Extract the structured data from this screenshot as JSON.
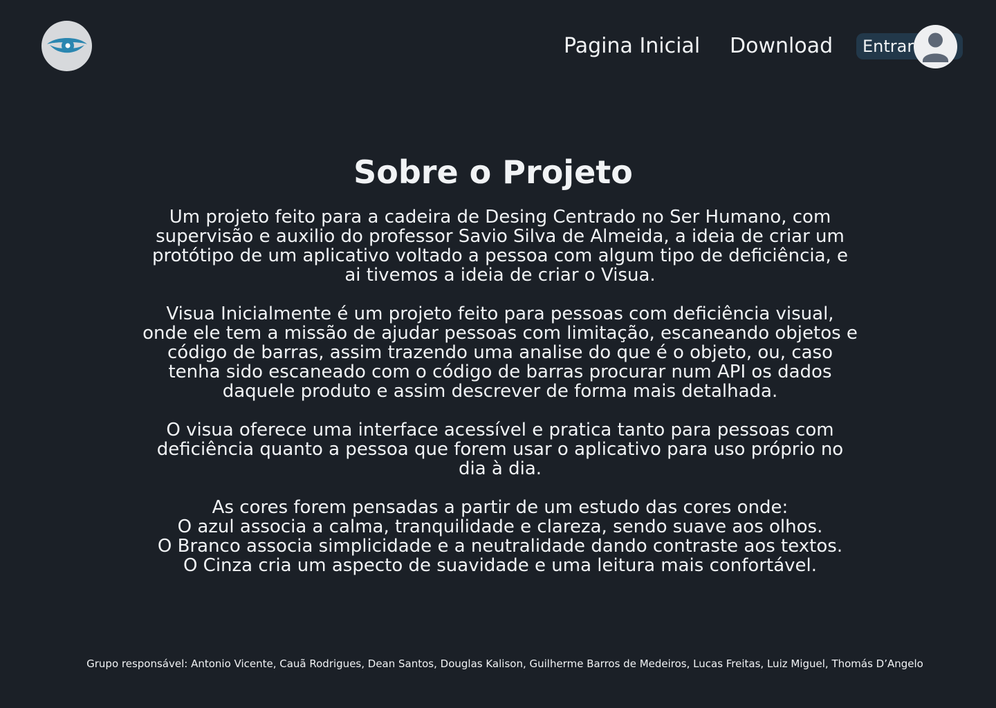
{
  "header": {
    "logo_icon": "eye-icon",
    "nav": [
      {
        "label": "Pagina Inicial"
      },
      {
        "label": "Download"
      }
    ],
    "login_label": "Entrar",
    "avatar_icon": "user-avatar-icon"
  },
  "main": {
    "title": "Sobre o Projeto",
    "paragraphs": [
      "Um projeto feito para a cadeira de Desing Centrado no Ser Humano, com supervisão e auxilio do professor Savio Silva de Almeida, a ideia de criar um protótipo de um aplicativo voltado a pessoa com algum tipo de deficiência, e ai tivemos a ideia de criar o Visua.",
      "Visua Inicialmente é um projeto feito para pessoas com deficiência visual, onde ele tem a missão de ajudar pessoas com limitação, escaneando objetos e código de barras, assim trazendo uma analise do que é o objeto, ou, caso tenha sido escaneado com o código de barras procurar num API os dados daquele produto e assim descrever de forma mais detalhada.",
      "O visua oferece uma interface acessível e pratica tanto para pessoas com deficiência quanto a pessoa que forem usar o aplicativo para uso próprio no dia à dia."
    ],
    "colors_section": {
      "intro": "As cores forem pensadas a partir de um estudo das cores onde:",
      "lines": [
        "O azul associa a calma, tranquilidade e clareza, sendo suave aos olhos.",
        "O Branco associa simplicidade e a neutralidade dando contraste aos textos.",
        "O Cinza cria um aspecto de suavidade e uma leitura mais confortável."
      ]
    }
  },
  "footer": {
    "credits": "Grupo responsável: Antonio Vicente, Cauã Rodrigues, Dean Santos, Douglas Kalison, Guilherme Barros de Medeiros, Lucas Freitas, Luiz Miguel, Thomás D’Angelo"
  },
  "colors": {
    "background": "#1b2027",
    "text": "#f1f3f5",
    "accent_blue": "#2a86b0",
    "login_bg": "#22384a"
  }
}
